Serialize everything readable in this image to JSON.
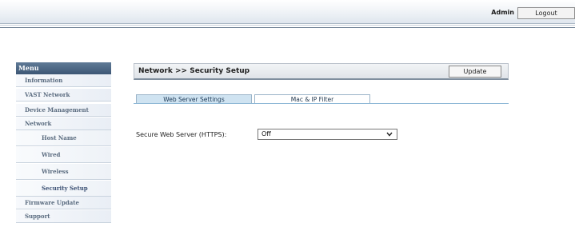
{
  "topbar": {
    "user_label": "Admin",
    "logout_label": "Logout"
  },
  "sidebar": {
    "menu_title": "Menu",
    "items": [
      {
        "label": "Information",
        "level": 0
      },
      {
        "label": "VAST Network",
        "level": 0
      },
      {
        "label": "Device Management",
        "level": 0
      },
      {
        "label": "Network",
        "level": 0
      },
      {
        "label": "Host Name",
        "level": 1
      },
      {
        "label": "Wired",
        "level": 1
      },
      {
        "label": "Wireless",
        "level": 1
      },
      {
        "label": "Security Setup",
        "level": 1,
        "active": true
      },
      {
        "label": "Firmware Update",
        "level": 0
      },
      {
        "label": "Support",
        "level": 0
      }
    ]
  },
  "main": {
    "breadcrumb": "Network >> Security Setup",
    "update_label": "Update",
    "tabs": [
      {
        "label": "Web Server Settings",
        "active": true
      },
      {
        "label": "Mac & IP Filter",
        "active": false
      }
    ],
    "https_field": {
      "label": "Secure Web Server (HTTPS):",
      "value": "Off"
    }
  },
  "colors": {
    "menu_header": "#4a6482",
    "active_tab": "#cfe3f1",
    "sidebar_text": "#5a6b7f"
  }
}
